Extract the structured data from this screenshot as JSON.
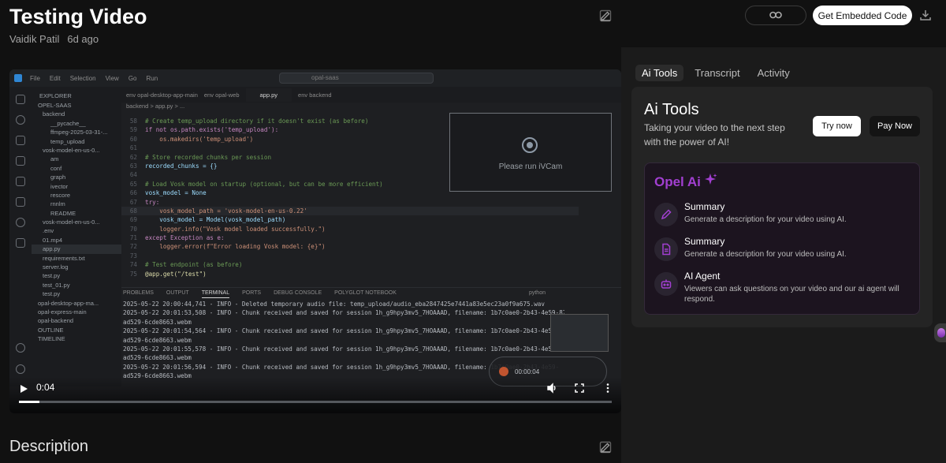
{
  "video": {
    "title": "Testing Video",
    "author": "Vaidik Patil",
    "age": "6d ago",
    "current_time": "0:04",
    "progress_fraction": 0.035
  },
  "actions": {
    "embed_label": "Get Embedded Code"
  },
  "description": {
    "heading": "Description"
  },
  "panel": {
    "tabs": [
      "Ai Tools",
      "Transcript",
      "Activity"
    ],
    "active_tab": "Ai Tools",
    "ai_tools": {
      "title": "Ai Tools",
      "subtitle": "Taking your video to the next step with the power of AI!",
      "try_label": "Try now",
      "pay_label": "Pay Now"
    },
    "opel_ai": {
      "title": "Opel Ai",
      "features": [
        {
          "name": "Summary",
          "desc": "Generate a description for your video using AI.",
          "icon": "pencil-icon"
        },
        {
          "name": "Summary",
          "desc": "Generate a description for your video using AI.",
          "icon": "document-icon"
        },
        {
          "name": "AI Agent",
          "desc": "Viewers can ask questions on your video and our ai agent will respond.",
          "icon": "bot-icon"
        }
      ]
    }
  },
  "screen": {
    "menu": [
      "File",
      "Edit",
      "Selection",
      "View",
      "Go",
      "Run"
    ],
    "search": "opal-saas",
    "explorer_header": "EXPLORER",
    "explorer": [
      "OPEL-SAAS",
      "backend",
      "__pycache__",
      "ffmpeg-2025-03-31-...",
      "temp_upload",
      "vosk-model-en-us-0...",
      "am",
      "conf",
      "graph",
      "ivector",
      "rescore",
      "rnnlm",
      "README",
      "vosk-model-en-us-0...",
      ".env",
      "01.mp4",
      "app.py",
      "requirements.txt",
      "server.log",
      "test.py",
      "test_01.py",
      "test.py",
      "opal-desktop-app-ma...",
      "opal-express-main",
      "opal-backend",
      "OUTLINE",
      "TIMELINE"
    ],
    "editor_tabs": [
      "env opal-desktop-app-main",
      "env opal-web",
      "app.py",
      "env backend"
    ],
    "active_editor_tab": "app.py",
    "breadcrumb": "backend > app.py > ...",
    "code": [
      {
        "n": "58",
        "t": "# Create temp_upload directory if it doesn't exist (as before)"
      },
      {
        "n": "59",
        "t": "if not os.path.exists('temp_upload'):"
      },
      {
        "n": "60",
        "t": "    os.makedirs('temp_upload')"
      },
      {
        "n": "61",
        "t": ""
      },
      {
        "n": "62",
        "t": "# Store recorded chunks per session"
      },
      {
        "n": "63",
        "t": "recorded_chunks = {}"
      },
      {
        "n": "64",
        "t": ""
      },
      {
        "n": "65",
        "t": "# Load Vosk model on startup (optional, but can be more efficient)"
      },
      {
        "n": "66",
        "t": "vosk_model = None"
      },
      {
        "n": "67",
        "t": "try:"
      },
      {
        "n": "68",
        "t": "    vosk_model_path = 'vosk-model-en-us-0.22'"
      },
      {
        "n": "69",
        "t": "    vosk_model = Model(vosk_model_path)"
      },
      {
        "n": "70",
        "t": "    logger.info(\"Vosk model loaded successfully.\")"
      },
      {
        "n": "71",
        "t": "except Exception as e:"
      },
      {
        "n": "72",
        "t": "    logger.error(f\"Error loading Vosk model: {e}\")"
      },
      {
        "n": "73",
        "t": ""
      },
      {
        "n": "74",
        "t": "# Test endpoint (as before)"
      },
      {
        "n": "75",
        "t": "@app.get(\"/test\")"
      }
    ],
    "webcam_text": "Please run iVCam",
    "terminal_tabs": [
      "PROBLEMS",
      "OUTPUT",
      "TERMINAL",
      "PORTS",
      "DEBUG CONSOLE",
      "POLYGLOT NOTEBOOK"
    ],
    "active_terminal_tab": "TERMINAL",
    "terminal_lang": "python",
    "terminal": [
      "2025-05-22 20:00:44,741 - INFO - Deleted temporary audio file: temp_upload/audio_eba2847425e7441a83e5ec23a0f9a675.wav",
      "2025-05-22 20:01:53,508 - INFO - Chunk received and saved for session 1h_g9hpy3mv5_7HOAAAD, filename: 1b7c0ae0-2b43-4e59-872a-c767841",
      "ad529-6cde8663.webm",
      "2025-05-22 20:01:54,564 - INFO - Chunk received and saved for session 1h_g9hpy3mv5_7HOAAAD, filename: 1b7c0ae0-2b43-4e59-",
      "ad529-6cde8663.webm",
      "2025-05-22 20:01:55,578 - INFO - Chunk received and saved for session 1h_g9hpy3mv5_7HOAAAD, filename: 1b7c0ae0-2b43-4e59-",
      "ad529-6cde8663.webm",
      "2025-05-22 20:01:56,594 - INFO - Chunk received and saved for session 1h_g9hpy3mv5_7HOAAAD, filename: 1b7c0ae0-2b43-4e59-",
      "ad529-6cde8663.webm"
    ],
    "recording_time": "00:00:04"
  },
  "colors": {
    "opel_accent": "#a23fd1",
    "background": "#111111",
    "panel": "#1b1b1b"
  }
}
